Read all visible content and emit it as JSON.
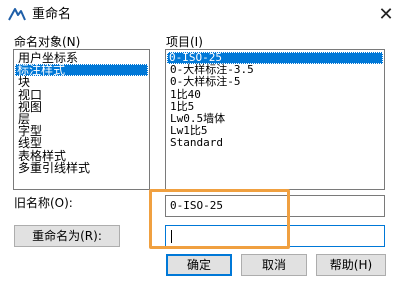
{
  "window": {
    "title": "重命名",
    "close_glyph": "✕",
    "app_icon": "autocad-icon"
  },
  "left_list": {
    "label": "命名对象(N)",
    "items": [
      "用户坐标系",
      "标注样式",
      "块",
      "视口",
      "视图",
      "层",
      "字型",
      "线型",
      "表格样式",
      "多重引线样式"
    ],
    "selected_index": 1
  },
  "right_list": {
    "label": "项目(I)",
    "items": [
      "0-ISO-25",
      "0-大样标注-3.5",
      "0-大样标注-5",
      "1比40",
      "1比5",
      "Lw0.5墙体",
      "Lw1比5",
      "Standard"
    ],
    "selected_index": 0
  },
  "old_name": {
    "label": "旧名称(O):",
    "value": "0-ISO-25"
  },
  "rename_to": {
    "button_label": "重命名为(R):",
    "value": ""
  },
  "buttons": {
    "ok": "确定",
    "cancel": "取消",
    "help": "帮助(H)"
  },
  "colors": {
    "selection": "#0078d7",
    "annotation_box": "#f0a040"
  }
}
